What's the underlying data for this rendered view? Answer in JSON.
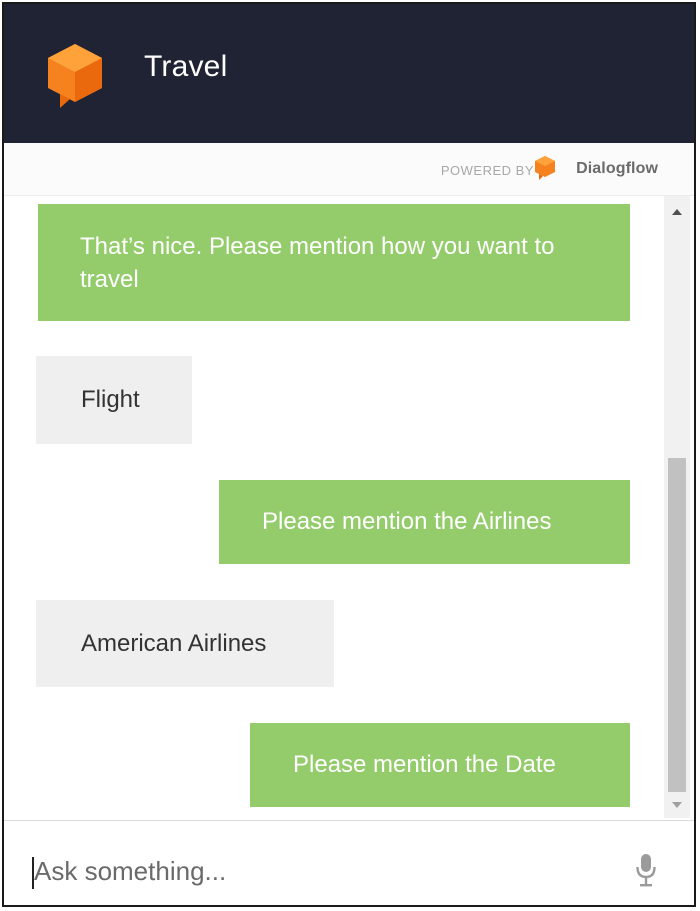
{
  "header": {
    "title": "Travel"
  },
  "powered_bar": {
    "powered_by": "POWERED BY",
    "brand": "Dialogflow"
  },
  "messages": [
    {
      "sender": "agent",
      "text": "That’s nice. Please mention how you want to travel"
    },
    {
      "sender": "user",
      "text": "Flight"
    },
    {
      "sender": "agent",
      "text": "Please mention the Airlines"
    },
    {
      "sender": "user",
      "text": "American Airlines"
    },
    {
      "sender": "agent",
      "text": "Please mention the Date"
    }
  ],
  "input": {
    "placeholder": "Ask something..."
  },
  "icons": {
    "logo": "dialogflow-cube-icon",
    "mic": "microphone-icon"
  },
  "colors": {
    "header_bg": "#1f2333",
    "agent_bubble": "#94cc6c",
    "user_bubble": "#efefef",
    "brand_orange": "#f5821f"
  }
}
